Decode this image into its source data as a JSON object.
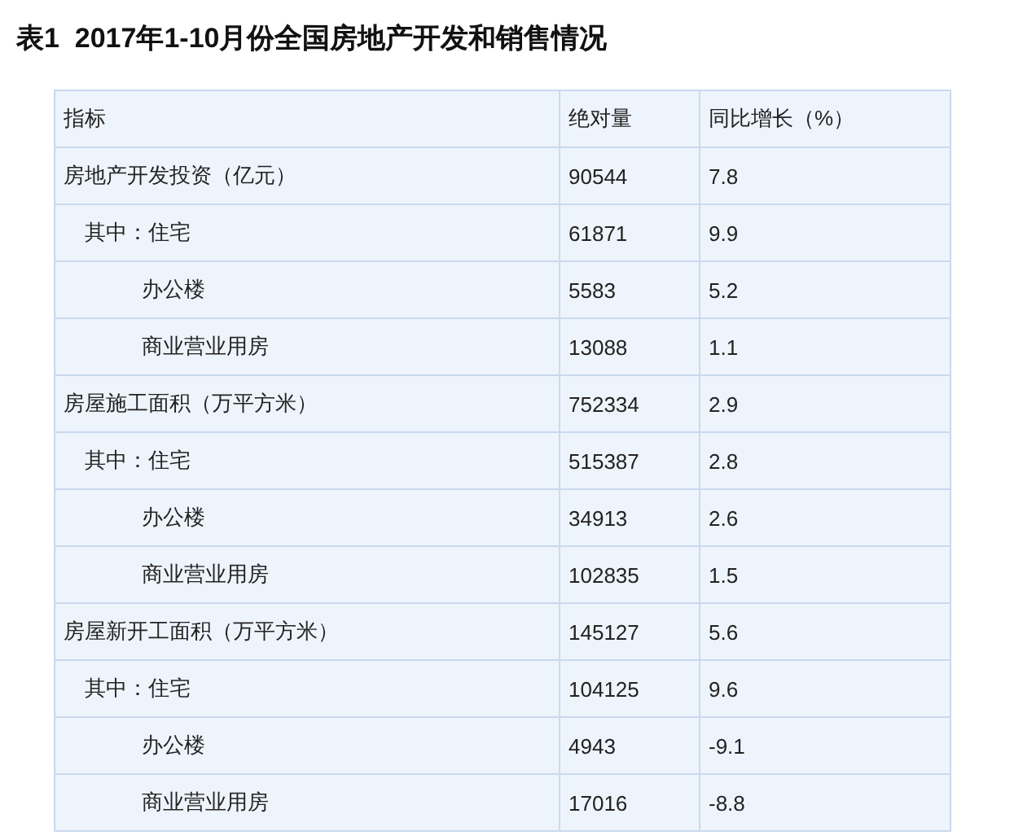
{
  "title": "表1  2017年1-10月份全国房地产开发和销售情况",
  "table": {
    "columns": [
      "指标",
      "绝对量",
      "同比增长（%）"
    ],
    "rows": [
      {
        "cells": [
          "房地产开发投资（亿元）",
          "90544",
          "7.8"
        ],
        "children": [
          {
            "cells": [
              "其中：住宅",
              "61871",
              "9.9"
            ],
            "children": [
              {
                "cells": [
                  "办公楼",
                  "5583",
                  "5.2"
                ]
              },
              {
                "cells": [
                  "商业营业用房",
                  "13088",
                  "1.1"
                ]
              }
            ]
          }
        ]
      },
      {
        "cells": [
          "房屋施工面积（万平方米）",
          "752334",
          "2.9"
        ],
        "children": [
          {
            "cells": [
              "其中：住宅",
              "515387",
              "2.8"
            ],
            "children": [
              {
                "cells": [
                  "办公楼",
                  "34913",
                  "2.6"
                ]
              },
              {
                "cells": [
                  "商业营业用房",
                  "102835",
                  "1.5"
                ]
              }
            ]
          }
        ]
      },
      {
        "cells": [
          "房屋新开工面积（万平方米）",
          "145127",
          "5.6"
        ],
        "children": [
          {
            "cells": [
              "其中：住宅",
              "104125",
              "9.6"
            ],
            "children": [
              {
                "cells": [
                  "办公楼",
                  "4943",
                  "-9.1"
                ]
              },
              {
                "cells": [
                  "商业营业用房",
                  "17016",
                  "-8.8"
                ]
              }
            ]
          }
        ]
      }
    ]
  }
}
